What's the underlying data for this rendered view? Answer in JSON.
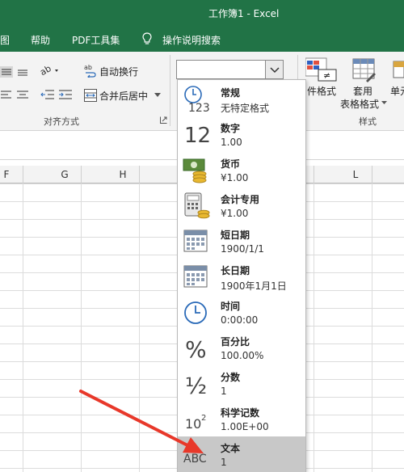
{
  "window": {
    "title": "工作簿1  -  Excel"
  },
  "menu": {
    "items": [
      {
        "key": "view",
        "label": "图"
      },
      {
        "key": "help",
        "label": "帮助"
      },
      {
        "key": "pdf",
        "label": "PDF工具集"
      },
      {
        "key": "tellme",
        "label": "操作说明搜索"
      }
    ]
  },
  "ribbon": {
    "wrap_text": "自动换行",
    "merge_center": "合并后居中",
    "alignment_group": "对齐方式",
    "conditional_format": "件格式",
    "table_format_line1": "套用",
    "table_format_line2": "表格格式",
    "cell_styles": "单元",
    "styles_group": "样式"
  },
  "number_format": {
    "value": ""
  },
  "columns": [
    "F",
    "G",
    "H",
    "L"
  ],
  "formats": [
    {
      "name": "常规",
      "sample": "无特定格式",
      "icon": "clock-123-icon"
    },
    {
      "name": "数字",
      "sample": "1.00",
      "icon": "number-12-icon"
    },
    {
      "name": "货币",
      "sample": "¥1.00",
      "icon": "currency-icon"
    },
    {
      "name": "会计专用",
      "sample": " ¥1.00",
      "icon": "accounting-icon"
    },
    {
      "name": "短日期",
      "sample": "1900/1/1",
      "icon": "calendar-icon"
    },
    {
      "name": "长日期",
      "sample": "1900年1月1日",
      "icon": "calendar-icon"
    },
    {
      "name": "时间",
      "sample": "0:00:00",
      "icon": "clock-icon"
    },
    {
      "name": "百分比",
      "sample": "100.00%",
      "icon": "percent-icon"
    },
    {
      "name": "分数",
      "sample": "1",
      "icon": "fraction-icon"
    },
    {
      "name": "科学记数",
      "sample": "1.00E+00",
      "icon": "scientific-icon"
    },
    {
      "name": "文本",
      "sample": "1",
      "icon": "abc-icon"
    }
  ],
  "selected_format": "文本",
  "colors": {
    "excel_green": "#217346",
    "arrow": "#e8382a",
    "selected_bg": "#c8c8c8"
  }
}
